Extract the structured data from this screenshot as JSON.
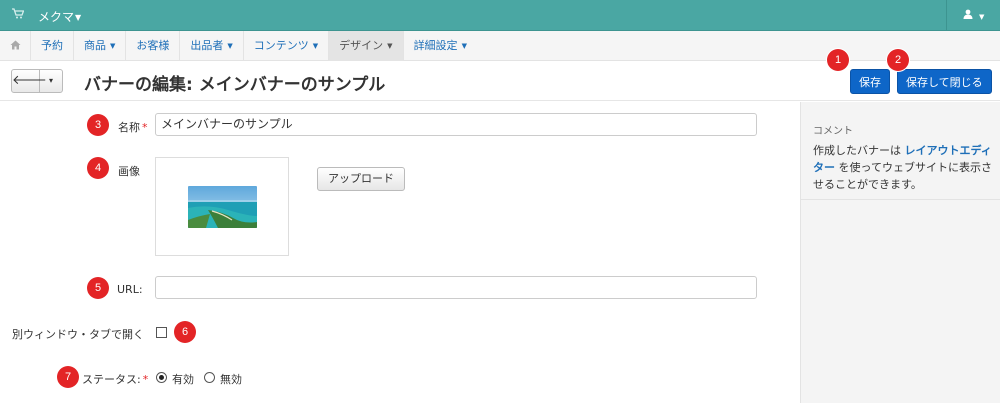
{
  "topbar": {
    "brand": "メクマ",
    "cart_icon": "cart-icon",
    "user_icon": "user-icon"
  },
  "nav": {
    "home_icon": "home-icon",
    "items": [
      {
        "label": "予約",
        "dropdown": false
      },
      {
        "label": "商品",
        "dropdown": true
      },
      {
        "label": "お客様",
        "dropdown": false
      },
      {
        "label": "出品者",
        "dropdown": true
      },
      {
        "label": "コンテンツ",
        "dropdown": true
      },
      {
        "label": "デザイン",
        "dropdown": true,
        "active": true
      },
      {
        "label": "詳細設定",
        "dropdown": true
      }
    ]
  },
  "titlebar": {
    "back_glyph": "🡐",
    "caret_glyph": "▾",
    "title": "バナーの編集: メインバナーのサンプル",
    "save_label": "保存",
    "save_close_label": "保存して閉じる"
  },
  "markers": [
    "1",
    "2",
    "3",
    "4",
    "5",
    "6",
    "7"
  ],
  "form": {
    "name_label": "名称",
    "required_mark": "*",
    "name_value": "メインバナーのサンプル",
    "image_label": "画像",
    "upload_label": "アップロード",
    "url_label": "URL:",
    "url_value": "",
    "new_window_label": "別ウィンドウ・タブで開く",
    "new_window_checked": false,
    "status_label": "ステータス:",
    "status_options": [
      "有効",
      "無効"
    ],
    "status_selected": "有効"
  },
  "sidebar": {
    "title": "コメント",
    "text_before": "作成したバナーは ",
    "link_text": "レイアウトエディター",
    "text_after": " を使ってウェブサイトに表示させることができます。"
  },
  "colors": {
    "topbar": "#4aa7a3",
    "primary": "#0e66c8",
    "marker": "#e32426",
    "link": "#1e6fb8"
  }
}
